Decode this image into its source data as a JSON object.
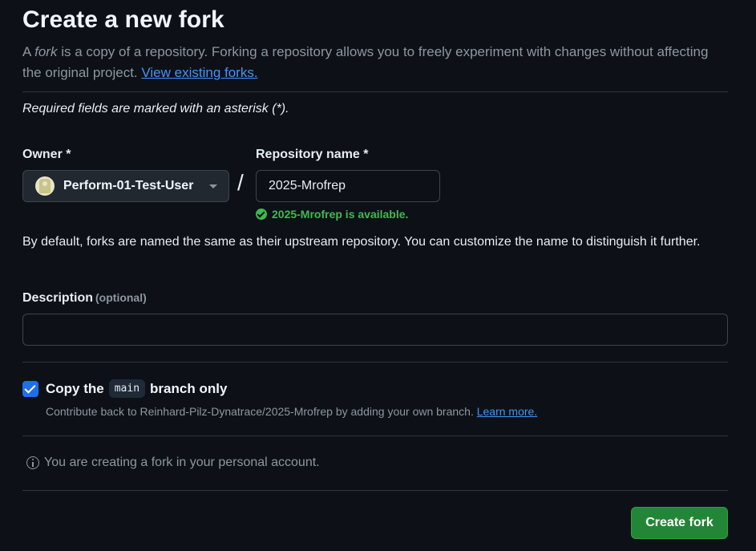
{
  "page": {
    "title": "Create a new fork",
    "intro_prefix": "A ",
    "intro_em": "fork",
    "intro_rest": " is a copy of a repository. Forking a repository allows you to freely experiment with changes without affecting the original project. ",
    "intro_link": "View existing forks.",
    "required_note": "Required fields are marked with an asterisk (*)."
  },
  "owner": {
    "label": "Owner *",
    "value": "Perform-01-Test-User",
    "avatar_icon": "avatar-icon"
  },
  "separator": "/",
  "repo": {
    "label": "Repository name *",
    "value": "2025-Mrofrep",
    "availability": "2025-Mrofrep is available.",
    "availability_color": "#3fb950"
  },
  "naming_hint": "By default, forks are named the same as their upstream repository. You can customize the name to distinguish it further.",
  "description": {
    "label": "Description",
    "optional": "(optional)",
    "value": ""
  },
  "copy_branch": {
    "checked": true,
    "label_before": "Copy the",
    "branch": "main",
    "label_after": "branch only",
    "help": "Contribute back to Reinhard-Pilz-Dynatrace/2025-Mrofrep by adding your own branch. ",
    "help_link": "Learn more."
  },
  "info": {
    "icon": "info-icon",
    "text": "You are creating a fork in your personal account."
  },
  "actions": {
    "create_label": "Create fork",
    "create_color": "#238636"
  },
  "colors": {
    "background": "#0d1117",
    "link": "#4493f8",
    "checkbox": "#1f6feb"
  }
}
